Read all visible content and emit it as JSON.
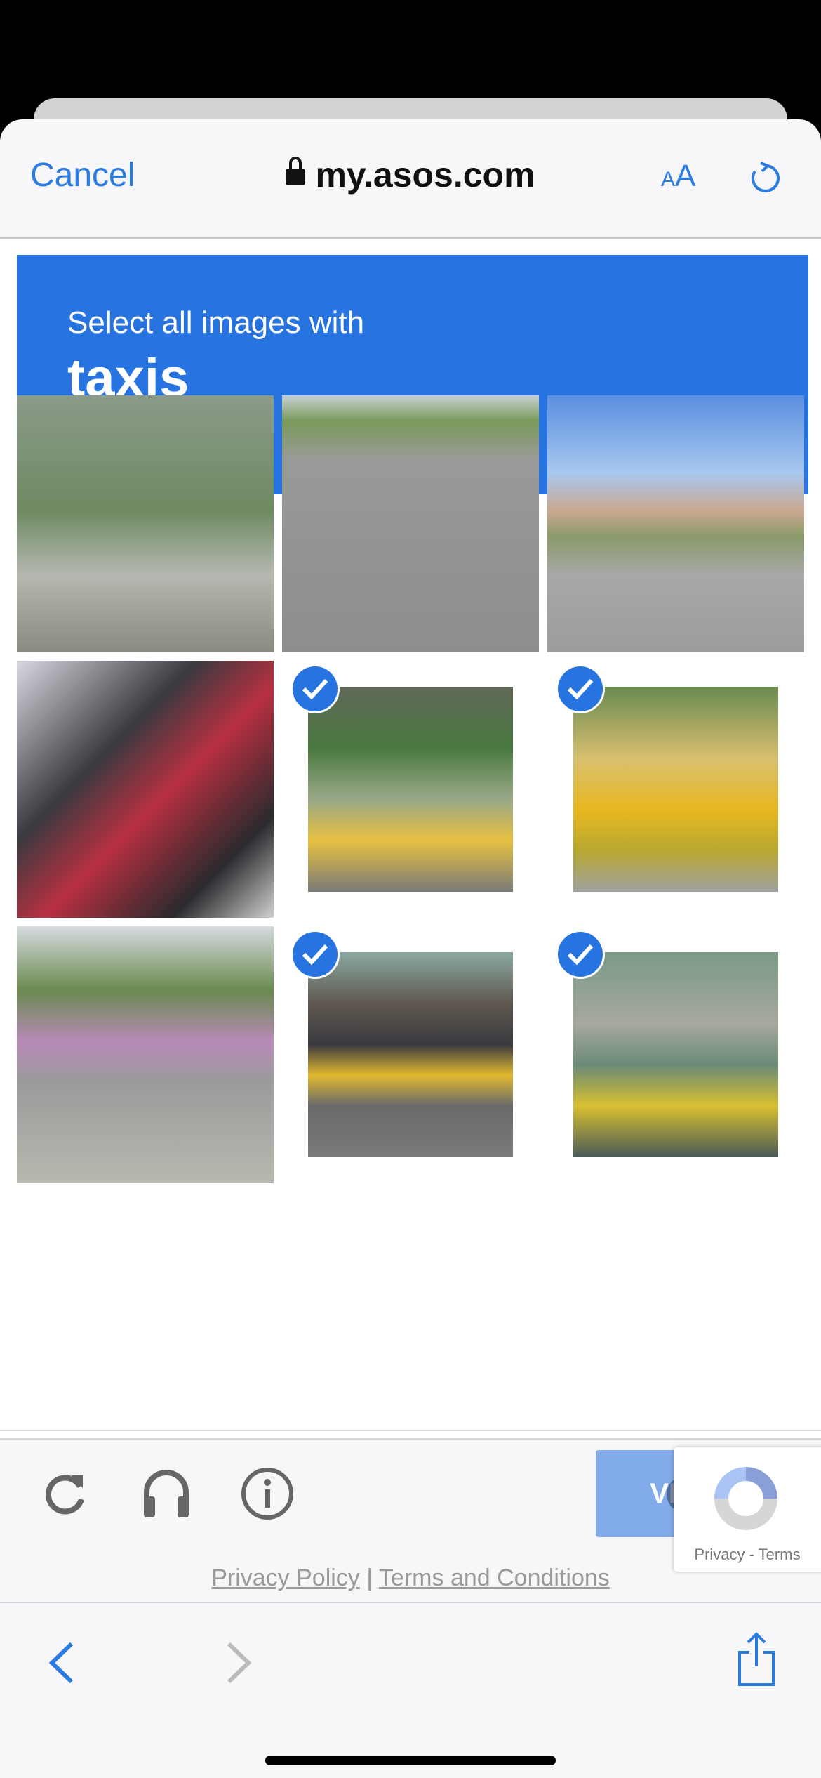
{
  "browser": {
    "cancel_label": "Cancel",
    "url": "my.asos.com",
    "text_size_label": "AA",
    "reload_icon": "reload-icon",
    "lock_icon": "lock-icon"
  },
  "captcha": {
    "instruction": "Select all images with",
    "target": "taxis",
    "accent_color": "#2774e0",
    "tiles": [
      {
        "content": "street with traffic light and tree",
        "selected": false
      },
      {
        "content": "scooter rider on road",
        "selected": false
      },
      {
        "content": "intersection with traffic lights",
        "selected": false
      },
      {
        "content": "parked motorcycles and traffic cone",
        "selected": false
      },
      {
        "content": "yellow taxi by green fence",
        "selected": true
      },
      {
        "content": "yellow taxis",
        "selected": true
      },
      {
        "content": "street with bus",
        "selected": false
      },
      {
        "content": "road with yellow taxi",
        "selected": true
      },
      {
        "content": "street with yellow taxi",
        "selected": true
      }
    ],
    "verify_label": "VERIFY",
    "footer_icons": [
      "reload-icon",
      "headphones-icon",
      "info-icon"
    ]
  },
  "recaptcha_badge": {
    "label": "Privacy - Terms"
  },
  "page_links": {
    "privacy": "Privacy Policy",
    "separator": "|",
    "terms": "Terms and Conditions"
  },
  "toolbar": {
    "icons": [
      "back-icon",
      "forward-icon",
      "share-icon"
    ]
  }
}
